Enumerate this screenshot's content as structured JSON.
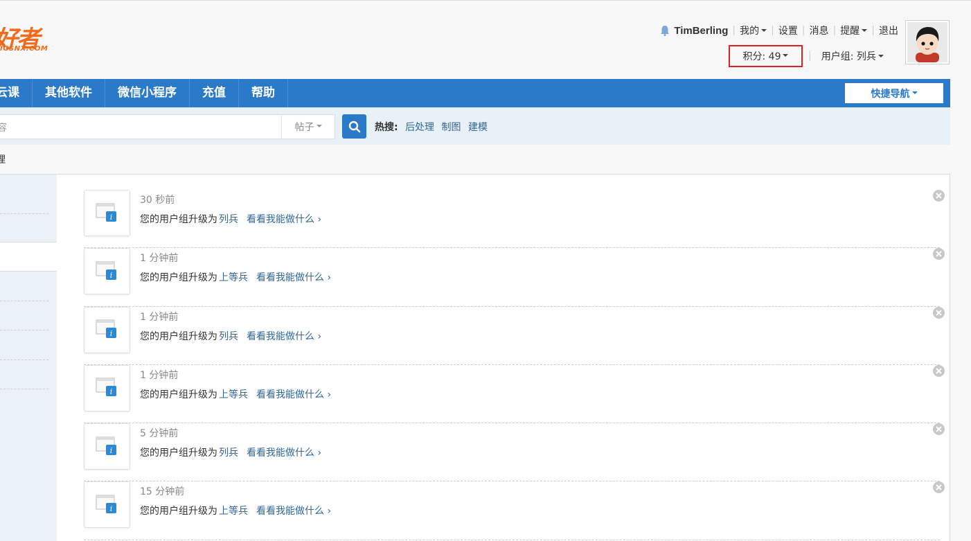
{
  "logo": {
    "main": "好者",
    "sub": "IGSNX.COM"
  },
  "userbar": {
    "username": "TimBerling",
    "mine": "我的",
    "settings": "设置",
    "messages": "消息",
    "reminders": "提醒",
    "logout": "退出",
    "credits": "积分: 49",
    "usergroup": "用户组: 列兵"
  },
  "nav": {
    "items": [
      "云课",
      "其他软件",
      "微信小程序",
      "充值",
      "帮助"
    ],
    "quick_nav": "快捷导航"
  },
  "search": {
    "placeholder_fragment": "容",
    "type": "帖子",
    "hot_label": "热搜:",
    "hot_terms": [
      "后处理",
      "制图",
      "建模"
    ]
  },
  "breadcrumb": "理",
  "notices": [
    {
      "time": "30 秒前",
      "text": "您的用户组升级为",
      "group": "列兵",
      "more": "看看我能做什么 ›"
    },
    {
      "time": "1 分钟前",
      "text": "您的用户组升级为",
      "group": "上等兵",
      "more": "看看我能做什么 ›"
    },
    {
      "time": "1 分钟前",
      "text": "您的用户组升级为",
      "group": "列兵",
      "more": "看看我能做什么 ›"
    },
    {
      "time": "1 分钟前",
      "text": "您的用户组升级为",
      "group": "上等兵",
      "more": "看看我能做什么 ›"
    },
    {
      "time": "5 分钟前",
      "text": "您的用户组升级为",
      "group": "列兵",
      "more": "看看我能做什么 ›"
    },
    {
      "time": "15 分钟前",
      "text": "您的用户组升级为",
      "group": "上等兵",
      "more": "看看我能做什么 ›"
    }
  ],
  "colors": {
    "nav": "#2b79c9",
    "link": "#336699",
    "logo": "#f26b1d",
    "highlight": "#e02020"
  }
}
